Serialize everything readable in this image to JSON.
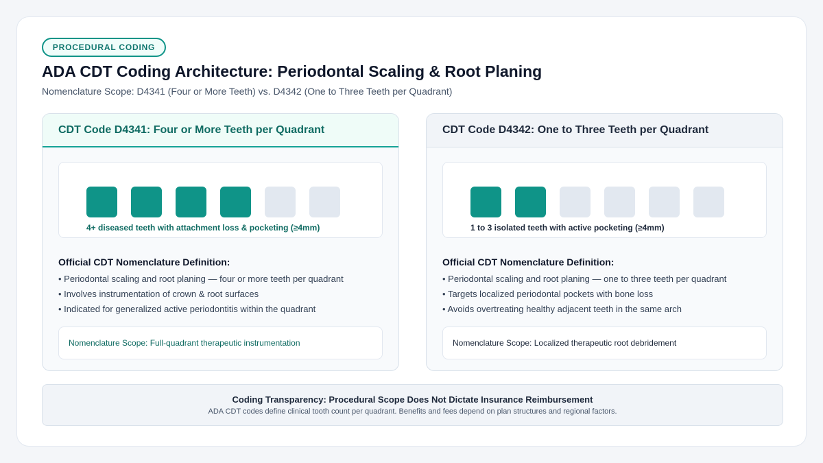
{
  "header": {
    "badge": "PROCEDURAL CODING",
    "title": "ADA CDT Coding Architecture: Periodontal Scaling & Root Planing",
    "subtitle": "Nomenclature Scope: D4341 (Four or More Teeth) vs. D4342 (One to Three Teeth per Quadrant)"
  },
  "panels": [
    {
      "title": "CDT Code D4341: Four or More Teeth per Quadrant",
      "teeth_total": 6,
      "teeth_affected": 4,
      "teeth_caption": "4+ diseased teeth with attachment loss & pocketing (≥4mm)",
      "definition_title": "Official CDT Nomenclature Definition:",
      "definition_items": [
        "Periodontal scaling and root planing — four or more teeth per quadrant",
        "Involves instrumentation of crown & root surfaces",
        "Indicated for generalized active periodontitis within the quadrant"
      ],
      "scope": "Nomenclature Scope: Full-quadrant therapeutic instrumentation"
    },
    {
      "title": "CDT Code D4342: One to Three Teeth per Quadrant",
      "teeth_total": 6,
      "teeth_affected": 2,
      "teeth_caption": "1 to 3 isolated teeth with active pocketing (≥4mm)",
      "definition_title": "Official CDT Nomenclature Definition:",
      "definition_items": [
        "Periodontal scaling and root planing — one to three teeth per quadrant",
        "Targets localized periodontal pockets with bone loss",
        "Avoids overtreating healthy adjacent teeth in the same arch"
      ],
      "scope": "Nomenclature Scope: Localized therapeutic root debridement"
    }
  ],
  "footer": {
    "title": "Coding Transparency: Procedural Scope Does Not Dictate Insurance Reimbursement",
    "text": "ADA CDT codes define clinical tooth count per quadrant. Benefits and fees depend on plan structures and regional factors."
  },
  "colors": {
    "accent": "#0f9488",
    "inactive_tooth": "#e2e8f0"
  }
}
